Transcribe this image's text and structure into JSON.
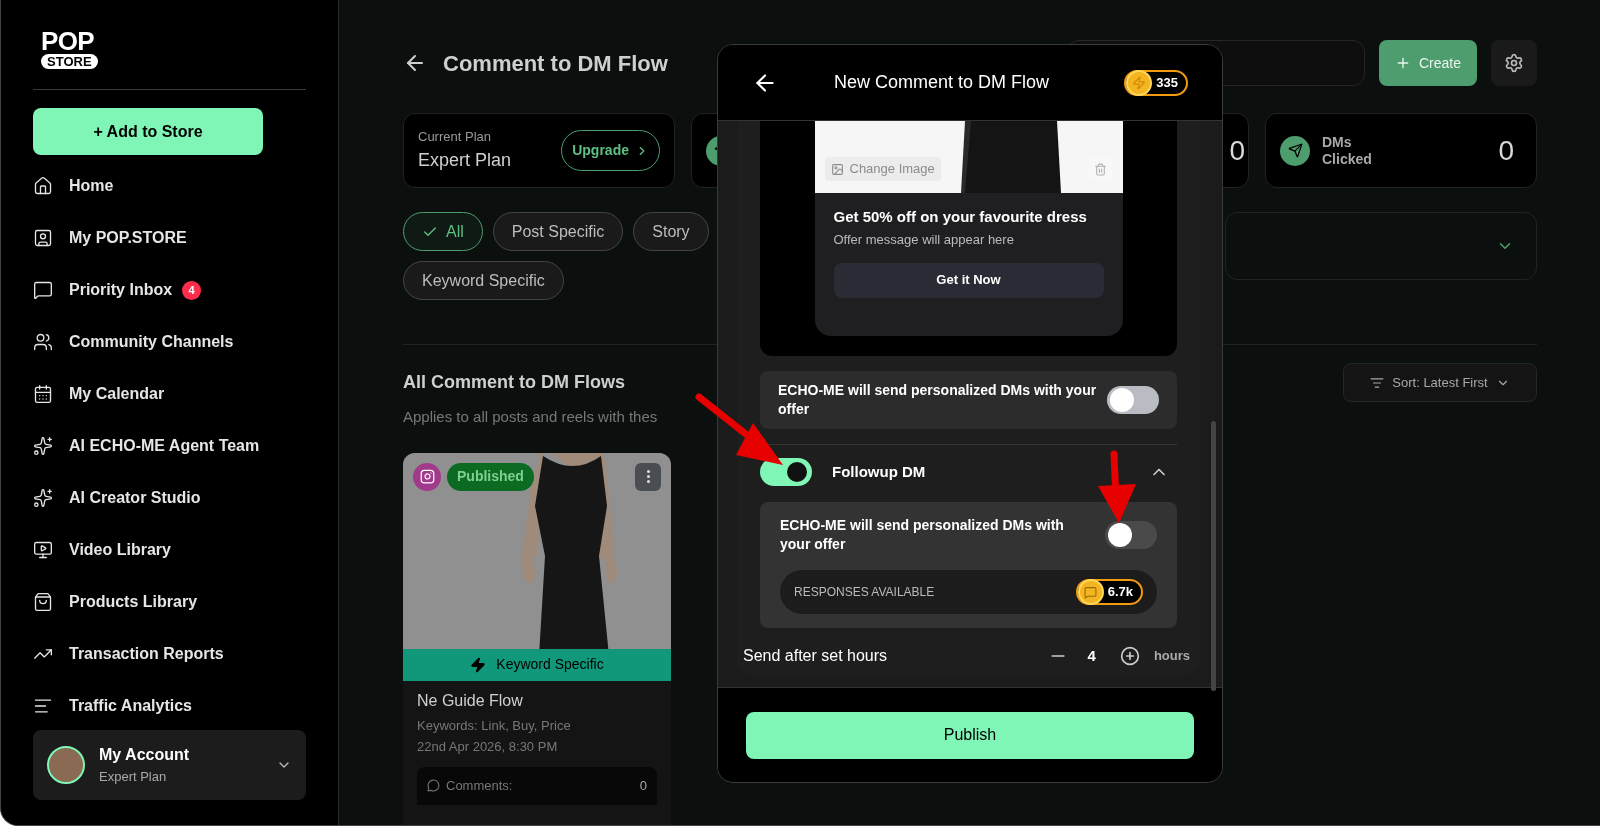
{
  "sidebar": {
    "logo": {
      "top": "POP",
      "bottom": "STORE"
    },
    "add_button": "+ Add to Store",
    "items": [
      {
        "label": "Home"
      },
      {
        "label": "My POP.STORE"
      },
      {
        "label": "Priority Inbox",
        "badge": "4"
      },
      {
        "label": "Community Channels"
      },
      {
        "label": "My Calendar"
      },
      {
        "label": "AI ECHO-ME Agent Team"
      },
      {
        "label": "AI Creator Studio"
      },
      {
        "label": "Video Library"
      },
      {
        "label": "Products Library"
      },
      {
        "label": "Transaction Reports"
      },
      {
        "label": "Traffic Analytics"
      }
    ],
    "account": {
      "name": "My Account",
      "plan": "Expert Plan"
    }
  },
  "page": {
    "title": "Comment to DM Flow",
    "create_button": "Create",
    "plan_card": {
      "label": "Current Plan",
      "value": "Expert Plan",
      "button": "Upgrade"
    },
    "stats": [
      {
        "value": "0"
      },
      {
        "label": "DMs\nClicked",
        "value": "0"
      }
    ],
    "filters": [
      {
        "label": "All",
        "selected": true
      },
      {
        "label": "Post Specific",
        "selected": false
      },
      {
        "label": "Story",
        "selected": false
      },
      {
        "label": "Keyword Specific",
        "selected": false
      }
    ],
    "section_title": "All Comment to DM Flows",
    "section_subtitle": "Applies to all posts and reels with thes",
    "sort": "Sort: Latest First",
    "flow_card": {
      "status": "Published",
      "trigger": "Keyword Specific",
      "name": "Ne Guide Flow",
      "keywords": "Keywords: Link, Buy, Price",
      "date": "22nd Apr 2026, 8:30 PM",
      "comments_label": "Comments:",
      "comments": "0"
    }
  },
  "modal": {
    "title": "New Comment to DM Flow",
    "credits": "335",
    "preview": {
      "change_image": "Change Image",
      "headline": "Get 50% off on your favourite dress",
      "message": "Offer message will appear here",
      "cta": "Get it Now"
    },
    "offer_toggle": {
      "label": "ECHO-ME will send personalized DMs with your offer",
      "on": false
    },
    "followup": {
      "label": "Followup DM",
      "on": true,
      "expanded": true,
      "personalized": {
        "label": "ECHO-ME will send personalized DMs with your offer",
        "on": false
      },
      "responses_label": "RESPONSES AVAILABLE",
      "responses": "6.7k",
      "delay_label": "Send after set hours",
      "hours": "4",
      "unit": "hours"
    },
    "publish": "Publish"
  }
}
